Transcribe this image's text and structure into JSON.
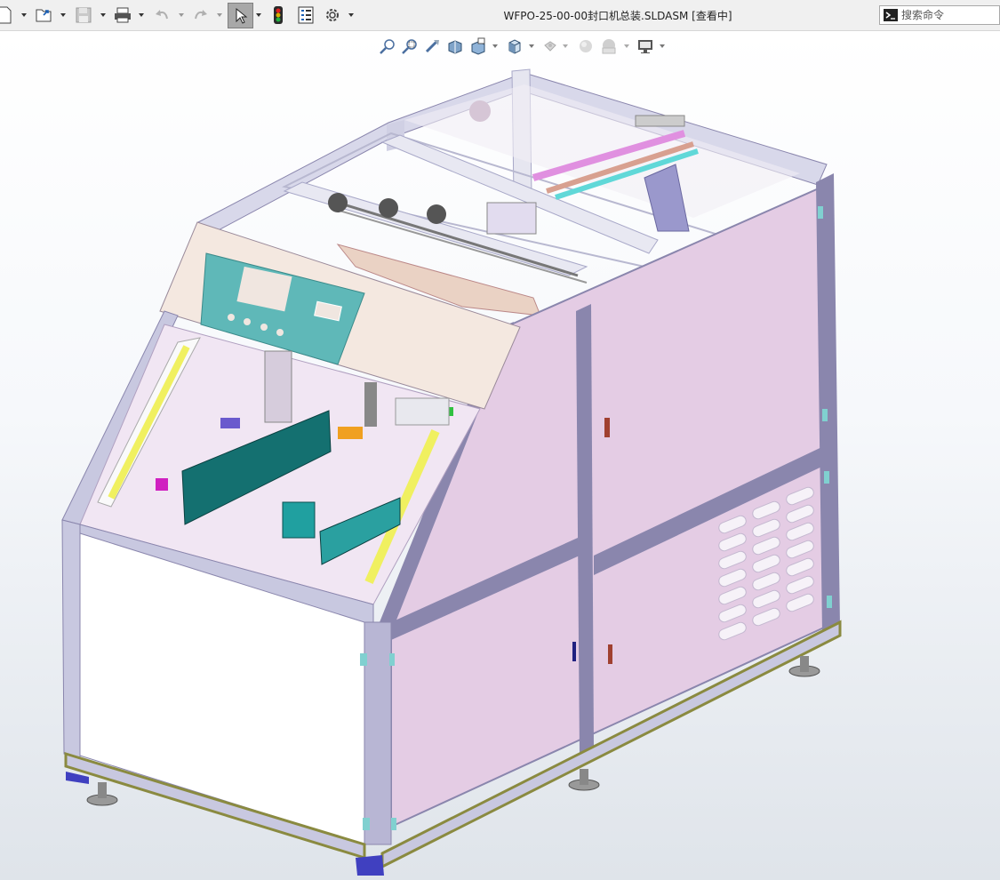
{
  "window": {
    "title": "WFPO-25-00-00封口机总装.SLDASM [查看中]"
  },
  "toolbar": {
    "buttons": [
      {
        "name": "new-document",
        "icon": "new-document-icon"
      },
      {
        "name": "open",
        "icon": "open-folder-icon"
      },
      {
        "name": "save",
        "icon": "save-icon"
      },
      {
        "name": "print",
        "icon": "print-icon"
      },
      {
        "name": "undo",
        "icon": "undo-icon"
      },
      {
        "name": "redo",
        "icon": "redo-icon"
      },
      {
        "name": "select",
        "icon": "select-arrow-icon",
        "active": true
      },
      {
        "name": "rebuild",
        "icon": "traffic-light-icon"
      },
      {
        "name": "file-properties",
        "icon": "file-properties-icon"
      },
      {
        "name": "options",
        "icon": "gear-icon"
      }
    ]
  },
  "search": {
    "placeholder": "搜索命令"
  },
  "heads_up_toolbar": [
    {
      "name": "zoom-to-fit",
      "icon": "zoom-to-fit-icon"
    },
    {
      "name": "zoom-to-area",
      "icon": "zoom-to-area-icon"
    },
    {
      "name": "previous-view",
      "icon": "previous-view-icon"
    },
    {
      "name": "section-view",
      "icon": "section-view-icon"
    },
    {
      "name": "dynamic-annotation-views",
      "icon": "annotation-view-icon"
    },
    {
      "name": "view-orientation",
      "icon": "view-orientation-icon"
    },
    {
      "name": "display-style",
      "icon": "display-style-icon"
    },
    {
      "name": "hide-show-items",
      "icon": "hide-show-icon"
    },
    {
      "name": "edit-appearance",
      "icon": "appearance-icon"
    },
    {
      "name": "apply-scene",
      "icon": "scene-icon"
    },
    {
      "name": "view-settings",
      "icon": "monitor-icon"
    }
  ],
  "colors": {
    "panel_pink": "#e4cce4",
    "frame_purple": "#8a86ad",
    "frame_light": "#c8c8e0",
    "front_panel": "#f4e8e0",
    "screen_teal": "#5fb8b8",
    "guard_teal": "#147070",
    "light_curtain_yellow": "#f0f060",
    "base_olive": "#8a8a40"
  }
}
